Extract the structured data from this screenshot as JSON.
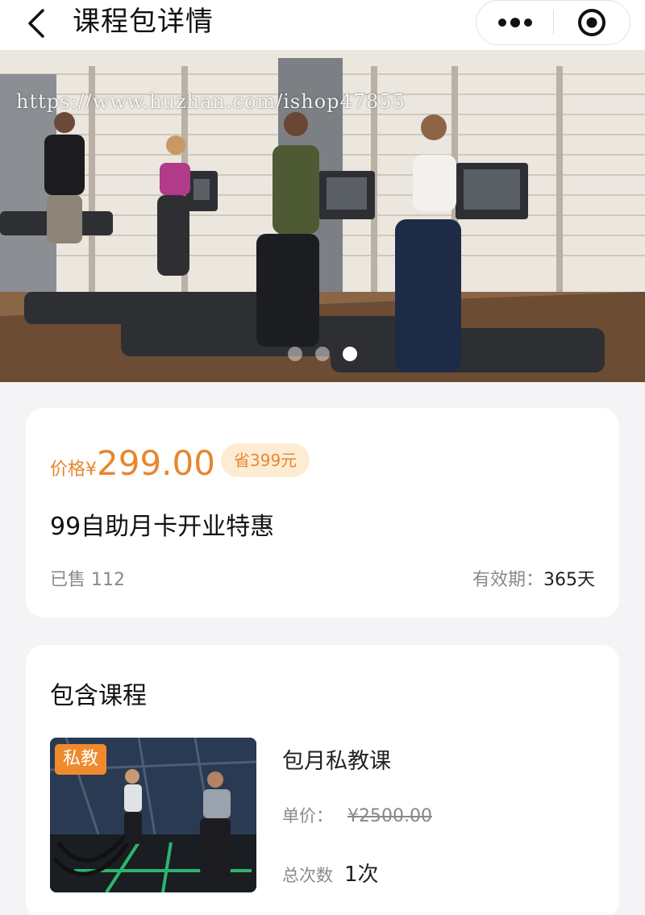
{
  "header": {
    "title": "课程包详情",
    "back_icon": "chevron-left-icon",
    "more_icon": "more-dots-icon",
    "close_icon": "target-circle-icon"
  },
  "banner": {
    "watermark": "https://www.huzhan.com/ishop47855",
    "slide_count": 3,
    "active_slide": 3,
    "image_description_icon": "gym-treadmill-photo"
  },
  "price_card": {
    "price_label": "价格",
    "currency": "¥",
    "price": "299.00",
    "save_badge": "省399元",
    "product_name": "99自助月卡开业特惠",
    "sold_label": "已售",
    "sold_count": "112",
    "validity_label": "有效期：",
    "validity_value": "365天"
  },
  "course_section": {
    "title": "包含课程",
    "course": {
      "tag": "私教",
      "name": "包月私教课",
      "unit_price_label": "单价：",
      "unit_price": "¥2500.00",
      "times_label": "总次数",
      "times_value": "1次"
    }
  },
  "colors": {
    "accent": "#e8862c",
    "badge_bg": "#fdecd4",
    "tag_bg": "#ef8a2f",
    "page_bg": "#f4f4f6"
  }
}
